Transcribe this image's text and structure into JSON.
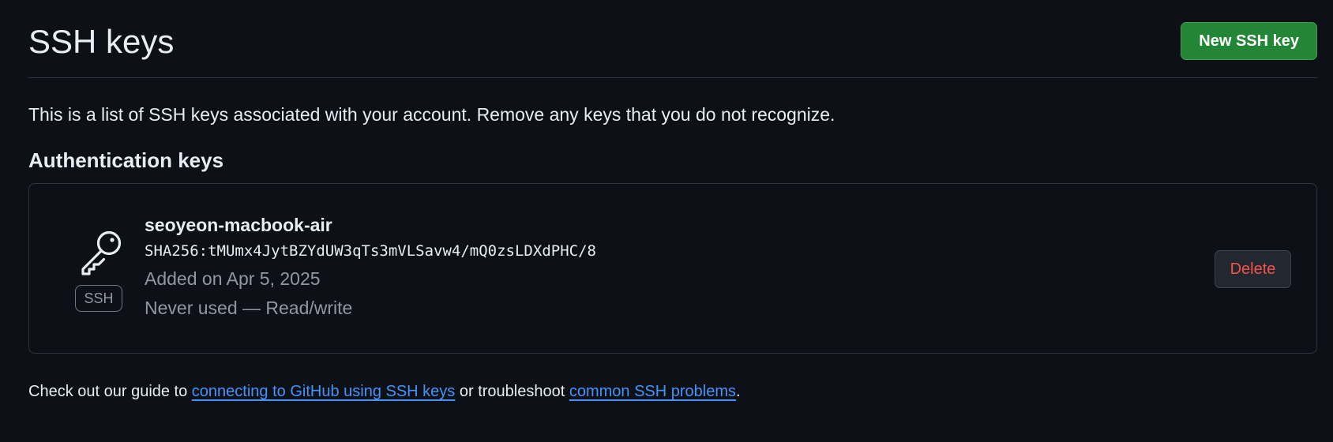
{
  "header": {
    "title": "SSH keys",
    "new_key_label": "New SSH key"
  },
  "intro": "This is a list of SSH keys associated with your account. Remove any keys that you do not recognize.",
  "section": {
    "title": "Authentication keys"
  },
  "keys": [
    {
      "icon": "key-icon",
      "badge": "SSH",
      "title": "seoyeon-macbook-air",
      "fingerprint": "SHA256:tMUmx4JytBZYdUW3qTs3mVLSavw4/mQ0zsLDXdPHC/8",
      "added": "Added on Apr 5, 2025",
      "usage": "Never used — Read/write",
      "delete_label": "Delete"
    }
  ],
  "footer": {
    "text_before": "Check out our guide to ",
    "link1": "connecting to GitHub using SSH keys",
    "text_middle": " or troubleshoot ",
    "link2": "common SSH problems",
    "text_after": "."
  },
  "colors": {
    "background": "#0d1117",
    "primary_button": "#238636",
    "danger_text": "#f85149",
    "link": "#4493f8",
    "border": "#30363d"
  }
}
